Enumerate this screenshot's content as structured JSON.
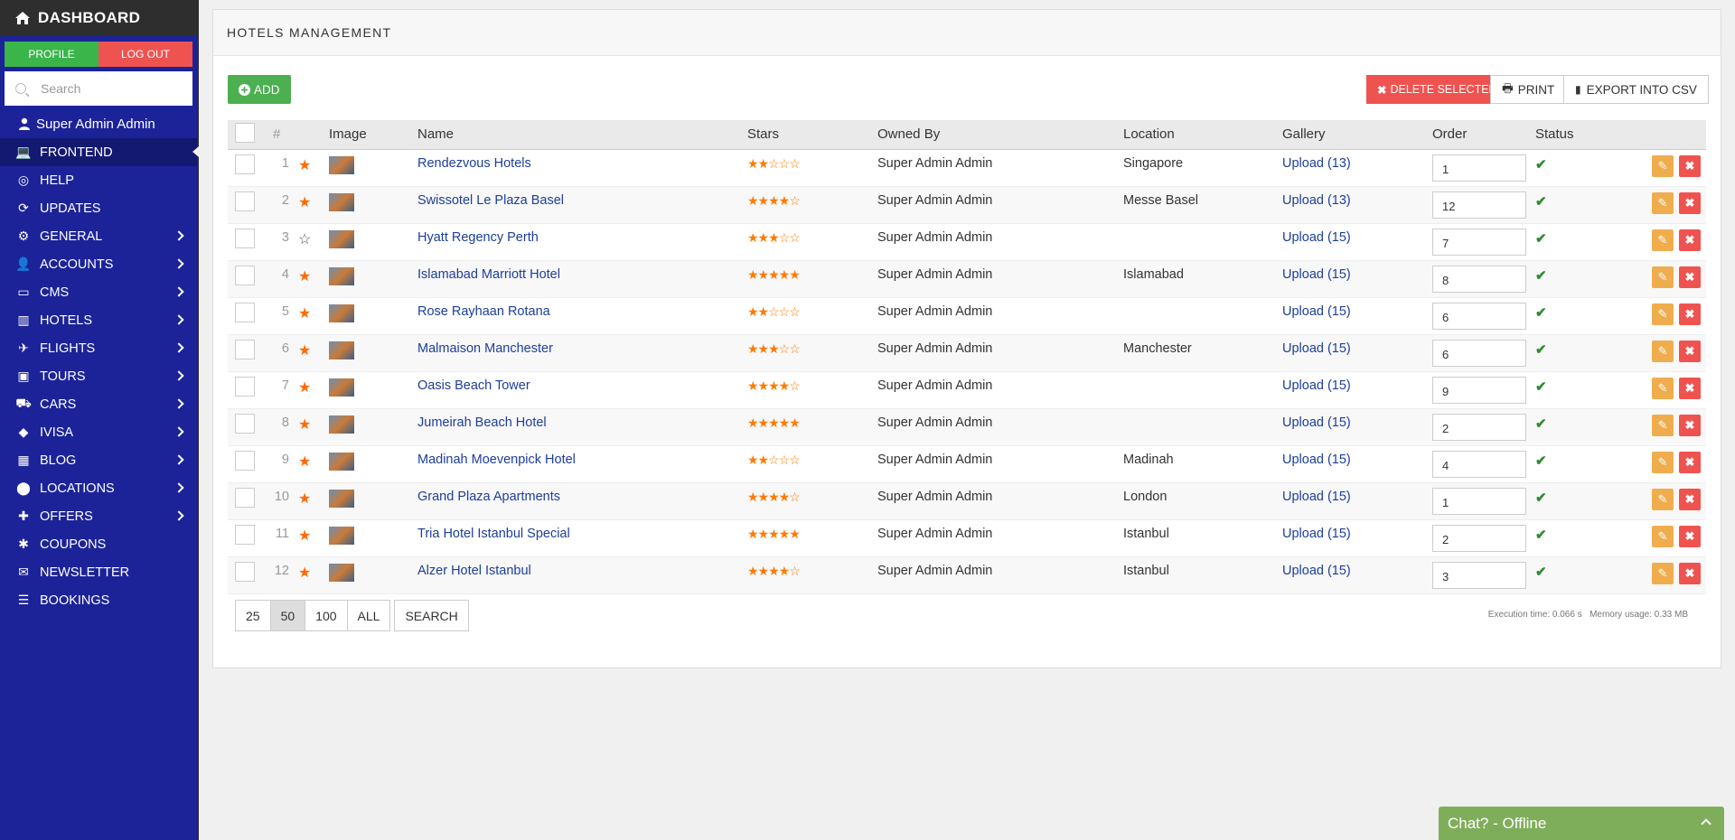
{
  "sidebar": {
    "title": "DASHBOARD",
    "profile_label": "PROFILE",
    "logout_label": "LOG OUT",
    "search_placeholder": "Search",
    "user": "Super Admin Admin",
    "items": [
      {
        "label": "FRONTEND",
        "icon": "laptop-icon",
        "active": true,
        "submenu": false
      },
      {
        "label": "HELP",
        "icon": "lifebuoy-icon",
        "submenu": false
      },
      {
        "label": "UPDATES",
        "icon": "refresh-icon",
        "submenu": false
      },
      {
        "label": "GENERAL",
        "icon": "gears-icon",
        "submenu": true
      },
      {
        "label": "ACCOUNTS",
        "icon": "user-icon",
        "submenu": true
      },
      {
        "label": "CMS",
        "icon": "monitor-icon",
        "submenu": true
      },
      {
        "label": "HOTELS",
        "icon": "building-icon",
        "submenu": true
      },
      {
        "label": "FLIGHTS",
        "icon": "plane-icon",
        "submenu": true
      },
      {
        "label": "TOURS",
        "icon": "suitcase-icon",
        "submenu": true
      },
      {
        "label": "CARS",
        "icon": "car-icon",
        "submenu": true
      },
      {
        "label": "IVISA",
        "icon": "tag-icon",
        "submenu": true
      },
      {
        "label": "BLOG",
        "icon": "grid-icon",
        "submenu": true
      },
      {
        "label": "LOCATIONS",
        "icon": "map-pin-icon",
        "submenu": true
      },
      {
        "label": "OFFERS",
        "icon": "gift-icon",
        "submenu": true
      },
      {
        "label": "COUPONS",
        "icon": "asterisk-icon",
        "submenu": false
      },
      {
        "label": "NEWSLETTER",
        "icon": "envelope-icon",
        "submenu": false
      },
      {
        "label": "BOOKINGS",
        "icon": "list-icon",
        "submenu": false
      }
    ]
  },
  "panel": {
    "title": "HOTELS MANAGEMENT",
    "add_label": "ADD",
    "delete_selected_label": "DELETE SELECTED",
    "print_label": "PRINT",
    "export_label": "EXPORT INTO CSV"
  },
  "table": {
    "headers": [
      "#",
      "Image",
      "Name",
      "Stars",
      "Owned By",
      "Location",
      "Gallery",
      "Order",
      "Status"
    ],
    "rows": [
      {
        "num": "1",
        "featured": true,
        "name": "Rendezvous Hotels",
        "stars": 2,
        "owner": "Super Admin Admin",
        "location": "Singapore",
        "gallery": "Upload (13)",
        "order": "1"
      },
      {
        "num": "2",
        "featured": true,
        "name": "Swissotel Le Plaza Basel",
        "stars": 4,
        "owner": "Super Admin Admin",
        "location": "Messe Basel",
        "gallery": "Upload (13)",
        "order": "12"
      },
      {
        "num": "3",
        "featured": false,
        "name": "Hyatt Regency Perth",
        "stars": 3,
        "owner": "Super Admin Admin",
        "location": "",
        "gallery": "Upload (15)",
        "order": "7"
      },
      {
        "num": "4",
        "featured": true,
        "name": "Islamabad Marriott Hotel",
        "stars": 5,
        "owner": "Super Admin Admin",
        "location": "Islamabad",
        "gallery": "Upload (15)",
        "order": "8"
      },
      {
        "num": "5",
        "featured": true,
        "name": "Rose Rayhaan Rotana",
        "stars": 2,
        "owner": "Super Admin Admin",
        "location": "",
        "gallery": "Upload (15)",
        "order": "6"
      },
      {
        "num": "6",
        "featured": true,
        "name": "Malmaison Manchester",
        "stars": 3,
        "owner": "Super Admin Admin",
        "location": "Manchester",
        "gallery": "Upload (15)",
        "order": "6"
      },
      {
        "num": "7",
        "featured": true,
        "name": "Oasis Beach Tower",
        "stars": 4,
        "owner": "Super Admin Admin",
        "location": "",
        "gallery": "Upload (15)",
        "order": "9"
      },
      {
        "num": "8",
        "featured": true,
        "name": "Jumeirah Beach Hotel",
        "stars": 5,
        "owner": "Super Admin Admin",
        "location": "",
        "gallery": "Upload (15)",
        "order": "2"
      },
      {
        "num": "9",
        "featured": true,
        "name": "Madinah Moevenpick Hotel",
        "stars": 2,
        "owner": "Super Admin Admin",
        "location": "Madinah",
        "gallery": "Upload (15)",
        "order": "4"
      },
      {
        "num": "10",
        "featured": true,
        "name": "Grand Plaza Apartments",
        "stars": 4,
        "owner": "Super Admin Admin",
        "location": "London",
        "gallery": "Upload (15)",
        "order": "1"
      },
      {
        "num": "11",
        "featured": true,
        "name": "Tria Hotel Istanbul Special",
        "stars": 5,
        "owner": "Super Admin Admin",
        "location": "Istanbul",
        "gallery": "Upload (15)",
        "order": "2"
      },
      {
        "num": "12",
        "featured": true,
        "name": "Alzer Hotel Istanbul",
        "stars": 4,
        "owner": "Super Admin Admin",
        "location": "Istanbul",
        "gallery": "Upload (15)",
        "order": "3"
      }
    ]
  },
  "pagination": {
    "options": [
      "25",
      "50",
      "100",
      "ALL"
    ],
    "selected": "50",
    "search_label": "SEARCH"
  },
  "footer": {
    "exec_time": "Execution time: 0.066 s",
    "memory": "Memory usage: 0.33 MB"
  },
  "chat": {
    "label": "Chat? - Offline"
  },
  "colors": {
    "sidebar_bg": "#1c2399",
    "accent_green": "#4caf50",
    "accent_red": "#ef5350",
    "star_orange": "#ff7a00"
  }
}
